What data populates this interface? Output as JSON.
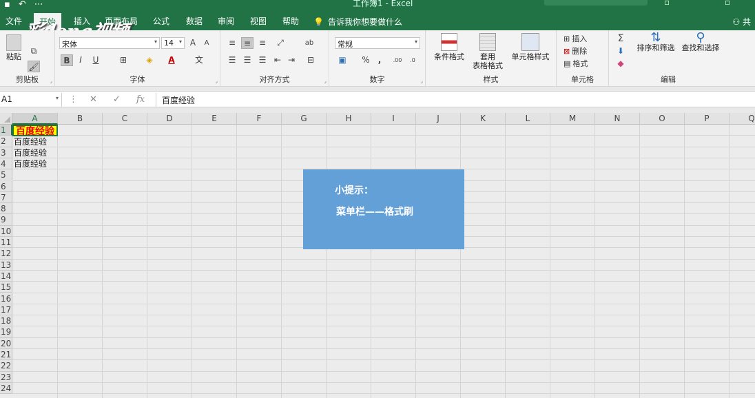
{
  "app": {
    "title": "工作簿1 - Excel",
    "logo_text": "彩dong视频",
    "share_label": "共"
  },
  "tabs": [
    {
      "label": "文件"
    },
    {
      "label": "开始"
    },
    {
      "label": "插入"
    },
    {
      "label": "页面布局"
    },
    {
      "label": "公式"
    },
    {
      "label": "数据"
    },
    {
      "label": "审阅"
    },
    {
      "label": "视图"
    },
    {
      "label": "帮助"
    }
  ],
  "tellme": "告诉我你想要做什么",
  "ribbon": {
    "clipboard": {
      "label": "剪贴板",
      "paste": "粘贴"
    },
    "font": {
      "label": "字体",
      "font_name": "宋体",
      "font_size": "14",
      "bold": "B",
      "italic": "I",
      "underline": "U",
      "grow": "A",
      "shrink": "A",
      "fontcolor": "A",
      "phonetic": "文"
    },
    "alignment": {
      "label": "对齐方式",
      "wrap": "ab"
    },
    "number": {
      "label": "数字",
      "format": "常规",
      "percent": "%",
      "comma": ",",
      "inc_dec": ".00",
      "dec_dec": ".0"
    },
    "styles": {
      "label": "样式",
      "conditional": "条件格式",
      "table_top": "套用",
      "table_bottom": "表格格式",
      "cell_styles": "单元格样式"
    },
    "cells": {
      "label": "单元格",
      "insert": "插入",
      "delete": "删除",
      "format": "格式"
    },
    "editing": {
      "label": "编辑",
      "sort": "排序和筛选",
      "find": "查找和选择"
    }
  },
  "formula_bar": {
    "name_box": "A1",
    "fx": "fx",
    "content": "百度经验"
  },
  "columns": [
    "A",
    "B",
    "C",
    "D",
    "E",
    "F",
    "G",
    "H",
    "I",
    "J",
    "K",
    "L",
    "M",
    "N",
    "O",
    "P",
    "Q"
  ],
  "rows": [
    "1",
    "2",
    "3",
    "4",
    "5",
    "6",
    "7",
    "8",
    "9",
    "10",
    "11",
    "12",
    "13",
    "14",
    "15",
    "16",
    "17",
    "18",
    "19",
    "20",
    "21",
    "22",
    "23",
    "24"
  ],
  "cells": {
    "A1": "百度经验",
    "A2": "百度经验",
    "A3": "百度经验",
    "A4": "百度经验"
  },
  "tip": {
    "line1": "小提示：",
    "line2": "菜单栏——格式刷"
  },
  "colors": {
    "accent": "#217346",
    "highlight": "#ffff00",
    "red_text": "#e60000",
    "tip_box": "#64a0d8"
  }
}
